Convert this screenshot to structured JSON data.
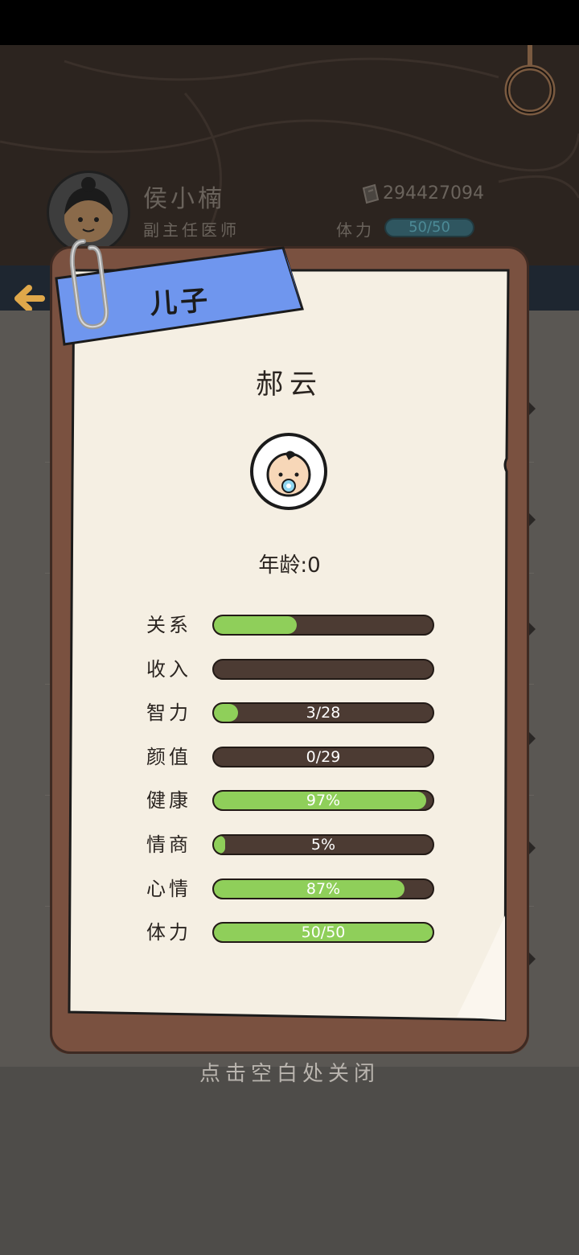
{
  "player": {
    "name": "侯小楠",
    "title": "副主任医师",
    "money": "294427094",
    "stamina_label": "体力",
    "stamina_value": "50/50"
  },
  "card": {
    "ribbon_label": "儿子",
    "child_name": "郝云",
    "age_text": "年龄:0",
    "stats": [
      {
        "label": "关系",
        "value": "",
        "fraction": 0.38
      },
      {
        "label": "收入",
        "value": "",
        "fraction": 0.0
      },
      {
        "label": "智力",
        "value": "3/28",
        "fraction": 0.11
      },
      {
        "label": "颜值",
        "value": "0/29",
        "fraction": 0.0
      },
      {
        "label": "健康",
        "value": "97%",
        "fraction": 0.97
      },
      {
        "label": "情商",
        "value": "5%",
        "fraction": 0.05
      },
      {
        "label": "心情",
        "value": "87%",
        "fraction": 0.87
      },
      {
        "label": "体力",
        "value": "50/50",
        "fraction": 1.0
      }
    ]
  },
  "close_hint": "点击空白处关闭",
  "colors": {
    "ribbon": "#6f96ee",
    "bar_fill": "#8fcf5a",
    "bar_track": "#4c3b33",
    "board": "#7a5140",
    "paper": "#f5efe3"
  }
}
